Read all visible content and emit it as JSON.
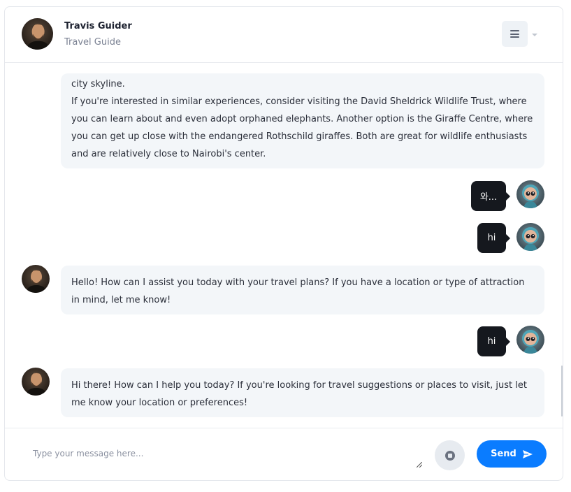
{
  "header": {
    "name": "Travis Guider",
    "role": "Travel Guide",
    "avatar_icon": "man-portrait-avatar",
    "menu_icon": "hamburger-menu-icon"
  },
  "messages": [
    {
      "sender": "bot",
      "text_lines": [
        "city skyline.",
        "If you're interested in similar experiences, consider visiting the David Sheldrick Wildlife Trust, where you can learn about and even adopt orphaned elephants. Another option is the Giraffe Centre, where you can get up close with the endangered Rothschild giraffes. Both are great for wildlife enthusiasts and are relatively close to Nairobi's center."
      ]
    },
    {
      "sender": "user",
      "text": "와..."
    },
    {
      "sender": "user",
      "text": "hi"
    },
    {
      "sender": "bot",
      "text": "Hello! How can I assist you today with your travel plans? If you have a location or type of attraction in mind, let me know!"
    },
    {
      "sender": "user",
      "text": "hi"
    },
    {
      "sender": "bot",
      "text": "Hi there! How can I help you today? If you're looking for travel suggestions or places to visit, just let me know your location or preferences!"
    }
  ],
  "composer": {
    "placeholder": "Type your message here...",
    "value": "",
    "send_label": "Send",
    "send_icon": "paper-plane-icon",
    "stop_icon": "stop-circle-icon"
  },
  "colors": {
    "accent": "#0a7cff",
    "user_bubble": "#15181e",
    "bot_bubble": "#f3f6f9"
  }
}
